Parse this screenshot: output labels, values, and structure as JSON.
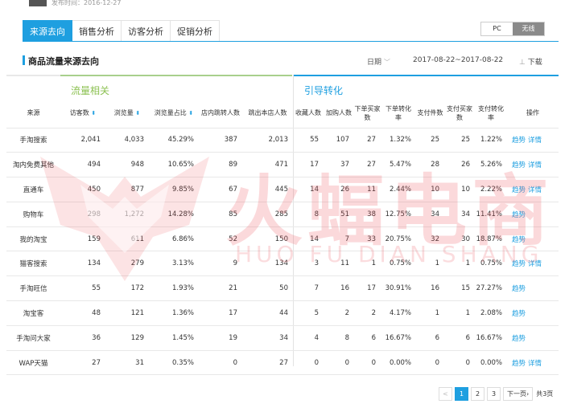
{
  "header": {
    "publish_time": "发布时间：2016-12-27"
  },
  "tabs": [
    {
      "label": "来源去向",
      "active": true
    },
    {
      "label": "销售分析",
      "active": false
    },
    {
      "label": "访客分析",
      "active": false
    },
    {
      "label": "促销分析",
      "active": false
    }
  ],
  "device_toggle": {
    "pc": "PC",
    "wireless": "无线"
  },
  "panel": {
    "title": "商品流量来源去向",
    "date_label": "日期",
    "date_range": "2017-08-22~2017-08-22",
    "download": "下载"
  },
  "groups": {
    "traffic": "流量相关",
    "guide": "引导转化"
  },
  "columns": {
    "source": "来源",
    "visitors": "访客数",
    "views": "浏览量",
    "view_share": "浏览量占比",
    "jump_in": "店内跳转人数",
    "jump_out": "跳出本店人数",
    "favorites": "收藏人数",
    "cart": "加购人数",
    "order_buyers_1": "下单买家",
    "order_buyers_2": "数",
    "order_conv_1": "下单转化",
    "order_conv_2": "率",
    "pay_items": "支付件数",
    "pay_buyers_1": "支付买家",
    "pay_buyers_2": "数",
    "pay_conv_1": "支付转化",
    "pay_conv_2": "率",
    "ops": "操作"
  },
  "rows": [
    {
      "source": "手淘搜索",
      "visitors": "2,041",
      "views": "4,033",
      "share": "45.29%",
      "jin": "387",
      "jout": "2,013",
      "fav": "55",
      "cart": "107",
      "ob": "27",
      "oc": "1.32%",
      "pi": "25",
      "pb": "25",
      "pc": "1.22%",
      "ops": [
        "趋势",
        "详情"
      ]
    },
    {
      "source": "淘内免费其他",
      "visitors": "494",
      "views": "948",
      "share": "10.65%",
      "jin": "89",
      "jout": "471",
      "fav": "17",
      "cart": "37",
      "ob": "27",
      "oc": "5.47%",
      "pi": "28",
      "pb": "26",
      "pc": "5.26%",
      "ops": [
        "趋势",
        "详情"
      ]
    },
    {
      "source": "直通车",
      "visitors": "450",
      "views": "877",
      "share": "9.85%",
      "jin": "67",
      "jout": "445",
      "fav": "14",
      "cart": "26",
      "ob": "11",
      "oc": "2.44%",
      "pi": "10",
      "pb": "10",
      "pc": "2.22%",
      "ops": [
        "趋势",
        "详情"
      ]
    },
    {
      "source": "购物车",
      "visitors": "298",
      "views": "1,272",
      "share": "14.28%",
      "jin": "85",
      "jout": "285",
      "fav": "8",
      "cart": "51",
      "ob": "38",
      "oc": "12.75%",
      "pi": "34",
      "pb": "34",
      "pc": "11.41%",
      "ops": [
        "趋势"
      ]
    },
    {
      "source": "我的淘宝",
      "visitors": "159",
      "views": "611",
      "share": "6.86%",
      "jin": "52",
      "jout": "150",
      "fav": "14",
      "cart": "7",
      "ob": "33",
      "oc": "20.75%",
      "pi": "32",
      "pb": "30",
      "pc": "18.87%",
      "ops": [
        "趋势"
      ]
    },
    {
      "source": "猫客搜索",
      "visitors": "134",
      "views": "279",
      "share": "3.13%",
      "jin": "9",
      "jout": "134",
      "fav": "3",
      "cart": "11",
      "ob": "1",
      "oc": "0.75%",
      "pi": "1",
      "pb": "1",
      "pc": "0.75%",
      "ops": [
        "趋势",
        "详情"
      ]
    },
    {
      "source": "手淘旺信",
      "visitors": "55",
      "views": "172",
      "share": "1.93%",
      "jin": "21",
      "jout": "50",
      "fav": "7",
      "cart": "16",
      "ob": "17",
      "oc": "30.91%",
      "pi": "16",
      "pb": "15",
      "pc": "27.27%",
      "ops": [
        "趋势"
      ]
    },
    {
      "source": "淘宝客",
      "visitors": "48",
      "views": "121",
      "share": "1.36%",
      "jin": "17",
      "jout": "44",
      "fav": "5",
      "cart": "2",
      "ob": "2",
      "oc": "4.17%",
      "pi": "1",
      "pb": "1",
      "pc": "2.08%",
      "ops": [
        "趋势"
      ]
    },
    {
      "source": "手淘问大家",
      "visitors": "36",
      "views": "129",
      "share": "1.45%",
      "jin": "19",
      "jout": "34",
      "fav": "4",
      "cart": "8",
      "ob": "6",
      "oc": "16.67%",
      "pi": "6",
      "pb": "6",
      "pc": "16.67%",
      "ops": [
        "趋势"
      ]
    },
    {
      "source": "WAP天猫",
      "visitors": "27",
      "views": "31",
      "share": "0.35%",
      "jin": "0",
      "jout": "27",
      "fav": "0",
      "cart": "0",
      "ob": "0",
      "oc": "0.00%",
      "pi": "0",
      "pb": "0",
      "pc": "0.00%",
      "ops": [
        "趋势",
        "详情"
      ]
    }
  ],
  "pagination": {
    "prev": "<",
    "pages": [
      "1",
      "2",
      "3"
    ],
    "current": "1",
    "next": "下一页",
    "total": "共3页"
  },
  "watermark": {
    "chinese": "火蝠电商",
    "pinyin": "HUO FU DIAN SHANG"
  },
  "colors": {
    "accent": "#1e9fe0",
    "traffic_group": "#8cc152",
    "watermark": "#eb505a"
  }
}
